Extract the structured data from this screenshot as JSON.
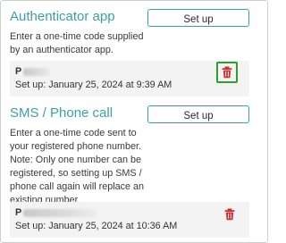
{
  "colors": {
    "accent": "#3aa0a8",
    "delete": "#d32f2f",
    "focus": "#2aa12a",
    "card": "#f3f3f3"
  },
  "authenticator": {
    "title": "Authenticator app",
    "setup_label": "Set up",
    "description": "Enter a one-time code supplied by an authenticator app.",
    "device": {
      "name": "P",
      "setup_date": "Set up: January 25, 2024 at 9:39 AM",
      "icon": "trash-icon"
    }
  },
  "sms": {
    "title": "SMS / Phone call",
    "setup_label": "Set up",
    "description": "Enter a one-time code sent to your registered phone number. Note: Only one number can be registered, so setting up SMS / phone call again will replace an existing number.",
    "device": {
      "name": "P",
      "setup_date": "Set up: January 25, 2024 at 10:36 AM",
      "icon": "trash-icon"
    }
  }
}
